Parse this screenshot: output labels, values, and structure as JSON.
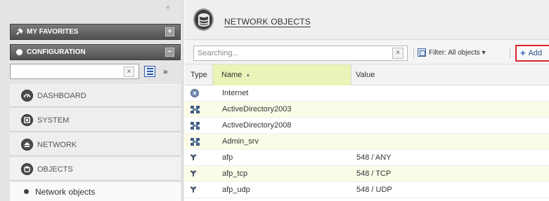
{
  "sidebar": {
    "collapse_icon": "«",
    "favorites": {
      "label": "MY FAVORITES",
      "icon": "pin-icon",
      "toggle": "+"
    },
    "configuration": {
      "label": "CONFIGURATION",
      "toggle": "−"
    },
    "search": {
      "value": "",
      "placeholder": "",
      "clear": "×"
    },
    "expand_icon": "»",
    "menu": [
      {
        "label": "DASHBOARD",
        "icon": "dashboard-icon"
      },
      {
        "label": "SYSTEM",
        "icon": "system-icon"
      },
      {
        "label": "NETWORK",
        "icon": "network-icon"
      },
      {
        "label": "OBJECTS",
        "icon": "objects-icon"
      }
    ],
    "submenu": {
      "label": "Network objects"
    }
  },
  "header": {
    "title": "NETWORK OBJECTS",
    "icon": "database-icon"
  },
  "toolbar": {
    "search_placeholder": "Searching...",
    "search_clear": "×",
    "filter_label": "Filter: All objects ▾",
    "add_label": "Add",
    "accent_color": "#e1232d"
  },
  "table": {
    "columns": {
      "type": "Type",
      "name": "Name",
      "name_sort": "▲",
      "value": "Value"
    },
    "rows": [
      {
        "type": "host-globe",
        "name": "Internet",
        "value": ""
      },
      {
        "type": "group",
        "name": "ActiveDirectory2003",
        "value": ""
      },
      {
        "type": "group",
        "name": "ActiveDirectory2008",
        "value": ""
      },
      {
        "type": "group",
        "name": "Admin_srv",
        "value": ""
      },
      {
        "type": "service",
        "name": "afp",
        "value": "548 / ANY"
      },
      {
        "type": "service",
        "name": "afp_tcp",
        "value": "548 / TCP"
      },
      {
        "type": "service",
        "name": "afp_udp",
        "value": "548 / UDP"
      }
    ]
  }
}
